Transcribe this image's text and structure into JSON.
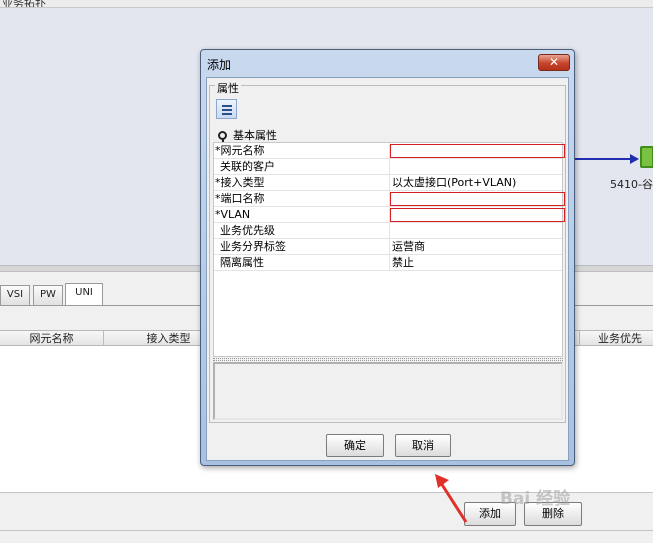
{
  "background_app": {
    "top_strip_text": "业务拓扑",
    "topology_node_label": "5410-谷",
    "tabs": [
      {
        "label": "VSI",
        "active": false
      },
      {
        "label": "PW",
        "active": false
      },
      {
        "label": "UNI",
        "active": true
      }
    ],
    "table_columns": [
      "网元名称",
      "接入类型",
      "业务优先"
    ],
    "buttons": {
      "add": "添加",
      "delete": "删除"
    }
  },
  "dialog": {
    "title": "添加",
    "close_symbol": "✕",
    "group_label": "属性",
    "section_label": "基本属性",
    "properties": [
      {
        "name": "*网元名称",
        "value": "",
        "required": true
      },
      {
        "name": "关联的客户",
        "value": "",
        "required": false
      },
      {
        "name": "*接入类型",
        "value": "以太虚接口(Port+VLAN)",
        "required": false
      },
      {
        "name": "*端口名称",
        "value": "",
        "required": true
      },
      {
        "name": "*VLAN",
        "value": "",
        "required": true
      },
      {
        "name": "业务优先级",
        "value": "",
        "required": false
      },
      {
        "name": "业务分界标签",
        "value": "运营商",
        "required": false
      },
      {
        "name": "隔离属性",
        "value": "禁止",
        "required": false
      }
    ],
    "ok_label": "确定",
    "cancel_label": "取消"
  },
  "watermark_text": "Bai 经验",
  "colors": {
    "required_border": "#d42020",
    "topology_link": "#1f2fb0",
    "annotation_arrow": "#e0302a",
    "close_button": "#c7452c"
  }
}
